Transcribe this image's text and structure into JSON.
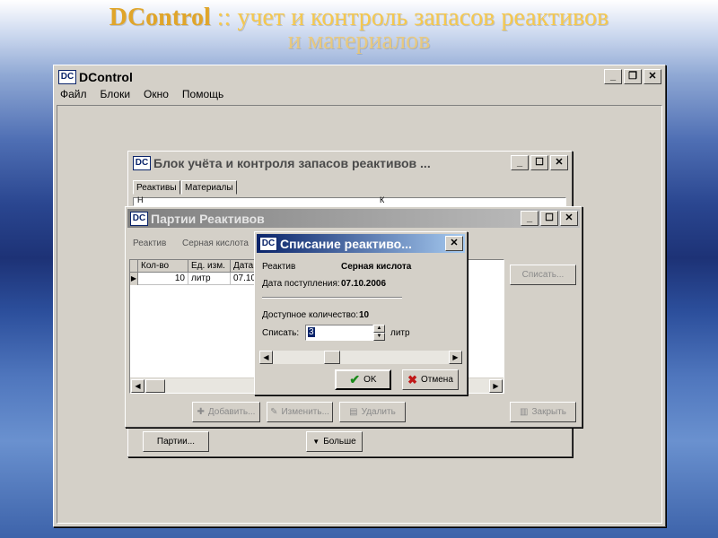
{
  "slide": {
    "title_brand": "DControl",
    "title_rest": " :: учет и контроль запасов реактивов",
    "title_line2": "и материалов"
  },
  "main_window": {
    "logo": "DC",
    "title": "DControl",
    "menu": [
      "Файл",
      "Блоки",
      "Окно",
      "Помощь"
    ]
  },
  "block_window": {
    "logo": "DC",
    "title": "Блок учёта и контроля запасов реактивов ...",
    "tabs": [
      "Реактивы",
      "Материалы"
    ],
    "header_cells": [
      "Н",
      "К"
    ],
    "partii_button": "Партии...",
    "more_button": "Больше"
  },
  "batches_window": {
    "logo": "DC",
    "title": "Партии Реактивов",
    "reagent_label": "Реактив",
    "reagent_value": "Серная кислота",
    "table_headers": [
      "Кол-во",
      "Ед. изм.",
      "Дата"
    ],
    "rows": [
      {
        "marker": "▶",
        "qty": "10",
        "unit": "литр",
        "date": "07.10"
      }
    ],
    "writeoff_button": "Списать...",
    "add_button": "Добавить...",
    "edit_button": "Изменить...",
    "delete_button": "Удалить",
    "close_button": "Закрыть"
  },
  "writeoff_dialog": {
    "logo": "DC",
    "title": "Списание реактиво...",
    "reagent_label": "Реактив",
    "reagent_value": "Серная кислота",
    "date_label": "Дата поступления:",
    "date_value": "07.10.2006",
    "available_label": "Доступное количество:",
    "available_value": "10",
    "writeoff_label": "Списать:",
    "writeoff_value": "3",
    "unit": "литр",
    "ok_button": "OK",
    "cancel_button": "Отмена"
  },
  "colors": {
    "title_gold": "#f5c84e",
    "active_caption": "#0a246a",
    "window_face": "#d4d0c8",
    "ok_check": "#1a8a1a",
    "cancel_x": "#c01818"
  },
  "icons": {
    "ok": "check-icon",
    "cancel": "x-icon",
    "spin_up": "spin-up-icon",
    "spin_down": "spin-down-icon",
    "row_pointer": "row-pointer-icon"
  }
}
